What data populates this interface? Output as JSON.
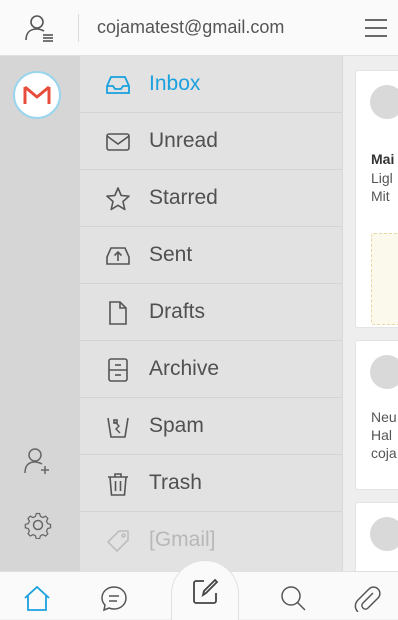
{
  "header": {
    "account_email": "cojamatest@gmail.com",
    "account_icon": "account-list-icon",
    "menu_icon": "hamburger-menu-icon"
  },
  "rail": {
    "accounts": [
      {
        "icon": "gmail-icon",
        "selected": true
      }
    ],
    "add_account_icon": "add-account-icon",
    "settings_icon": "settings-icon"
  },
  "folders": [
    {
      "label": "Inbox",
      "icon": "inbox-icon",
      "active": true
    },
    {
      "label": "Unread",
      "icon": "envelope-icon"
    },
    {
      "label": "Starred",
      "icon": "star-icon"
    },
    {
      "label": "Sent",
      "icon": "sent-icon"
    },
    {
      "label": "Drafts",
      "icon": "draft-icon"
    },
    {
      "label": "Archive",
      "icon": "archive-icon"
    },
    {
      "label": "Spam",
      "icon": "spam-icon"
    },
    {
      "label": "Trash",
      "icon": "trash-icon"
    },
    {
      "label": "[Gmail]",
      "icon": "tag-icon",
      "faded": true
    }
  ],
  "messages": [
    {
      "sender": "Mai",
      "lines": [
        "Ligl",
        "Mit"
      ]
    },
    {
      "sender": "",
      "lines": [
        "Neu",
        "Hal",
        "coja"
      ]
    },
    {
      "sender": "",
      "lines": []
    }
  ],
  "bottom_nav": [
    "home-icon",
    "chat-icon",
    "compose-icon",
    "search-icon",
    "attachment-icon"
  ],
  "colors": {
    "accent": "#1aa1de",
    "gmail_red": "#e74c3c"
  }
}
